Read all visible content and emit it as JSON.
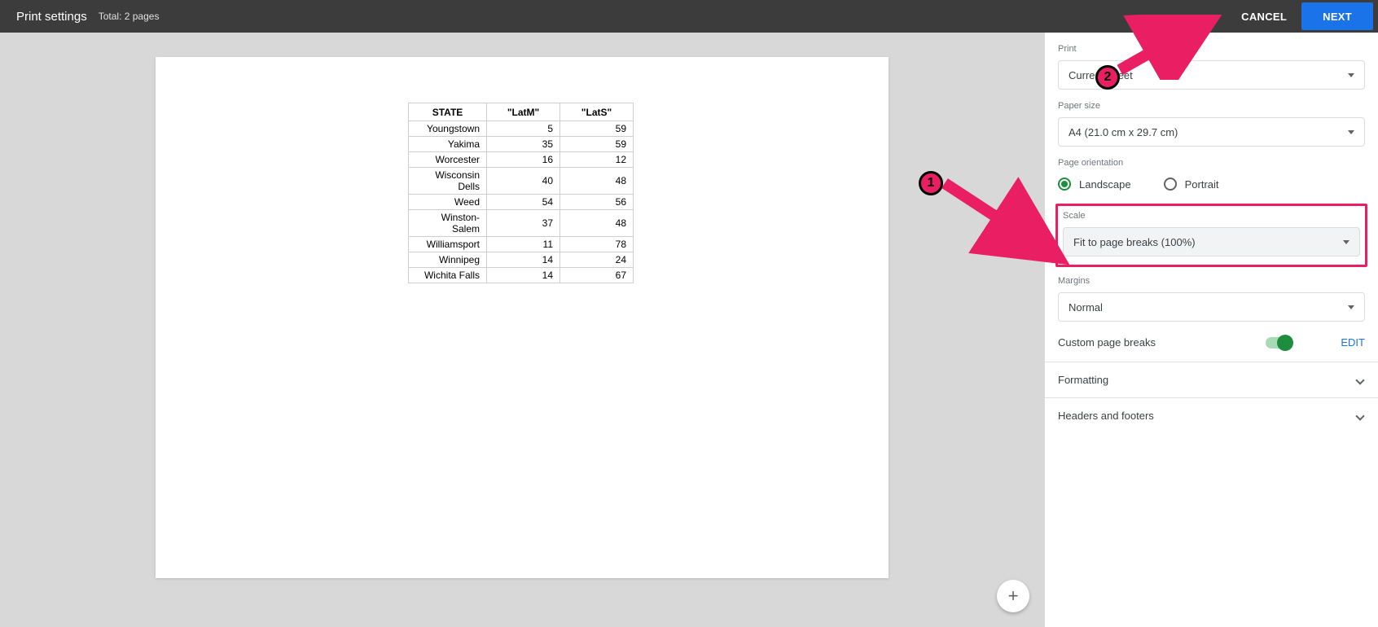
{
  "header": {
    "title": "Print settings",
    "subtitle": "Total: 2 pages",
    "cancel": "CANCEL",
    "next": "NEXT"
  },
  "table": {
    "columns": [
      "STATE",
      "\"LatM\"",
      "\"LatS\""
    ],
    "rows": [
      [
        "Youngstown",
        "5",
        "59"
      ],
      [
        "Yakima",
        "35",
        "59"
      ],
      [
        "Worcester",
        "16",
        "12"
      ],
      [
        "Wisconsin Dells",
        "40",
        "48"
      ],
      [
        "Weed",
        "54",
        "56"
      ],
      [
        "Winston-Salem",
        "37",
        "48"
      ],
      [
        "Williamsport",
        "11",
        "78"
      ],
      [
        "Winnipeg",
        "14",
        "24"
      ],
      [
        "Wichita Falls",
        "14",
        "67"
      ]
    ]
  },
  "sidebar": {
    "print_label": "Print",
    "print_value": "Current sheet",
    "paper_label": "Paper size",
    "paper_value": "A4 (21.0 cm x 29.7 cm)",
    "orient_label": "Page orientation",
    "orient_landscape": "Landscape",
    "orient_portrait": "Portrait",
    "scale_label": "Scale",
    "scale_value": "Fit to page breaks (100%)",
    "margins_label": "Margins",
    "margins_value": "Normal",
    "custom_breaks": "Custom page breaks",
    "edit": "EDIT",
    "formatting": "Formatting",
    "headers_footers": "Headers and footers"
  },
  "annotations": {
    "step1": "1",
    "step2": "2"
  },
  "chart_data": {
    "type": "table",
    "columns": [
      "STATE",
      "LatM",
      "LatS"
    ],
    "rows": [
      [
        "Youngstown",
        5,
        59
      ],
      [
        "Yakima",
        35,
        59
      ],
      [
        "Worcester",
        16,
        12
      ],
      [
        "Wisconsin Dells",
        40,
        48
      ],
      [
        "Weed",
        54,
        56
      ],
      [
        "Winston-Salem",
        37,
        48
      ],
      [
        "Williamsport",
        11,
        78
      ],
      [
        "Winnipeg",
        14,
        24
      ],
      [
        "Wichita Falls",
        14,
        67
      ]
    ]
  }
}
